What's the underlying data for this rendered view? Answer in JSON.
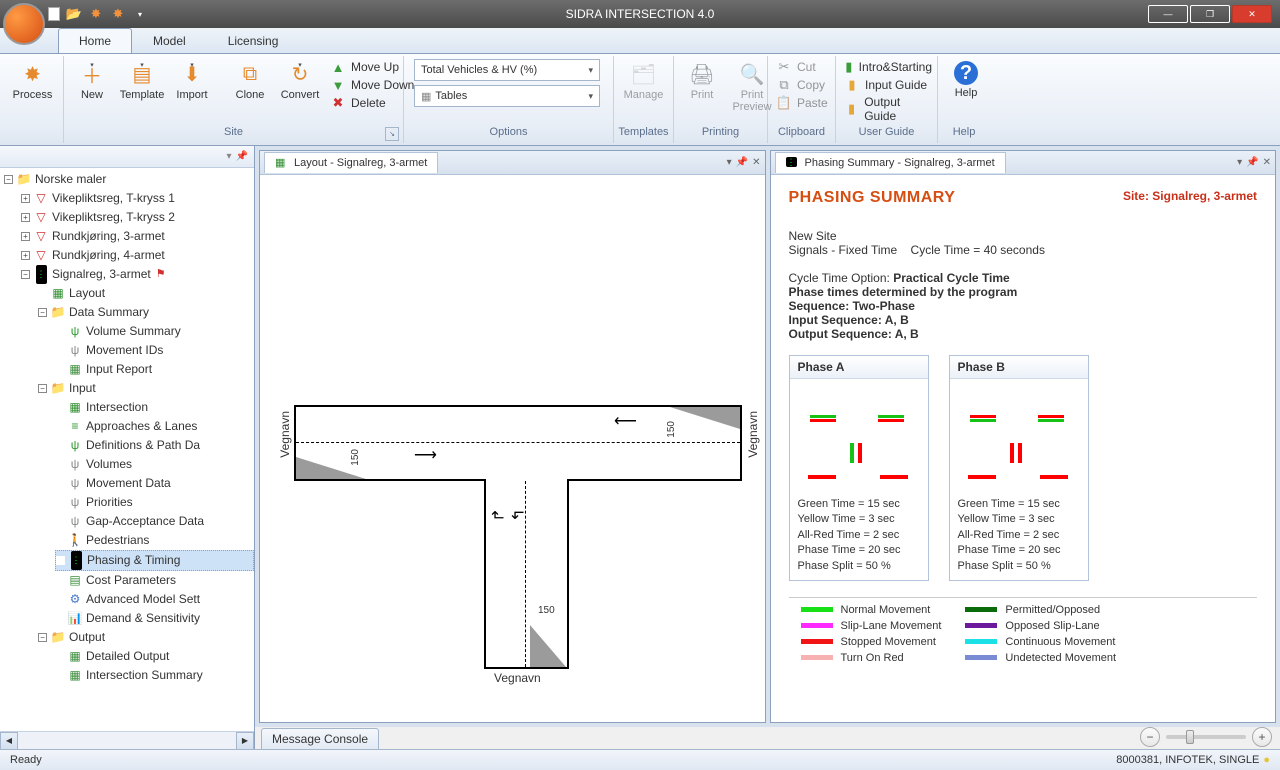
{
  "app": {
    "title": "SIDRA INTERSECTION 4.0"
  },
  "tabs": {
    "home": "Home",
    "model": "Model",
    "licensing": "Licensing"
  },
  "ribbon": {
    "process": "Process",
    "new": "New",
    "template": "Template",
    "import": "Import",
    "clone": "Clone",
    "convert": "Convert",
    "moveup": "Move Up",
    "movedown": "Move Down",
    "delete": "Delete",
    "combo1": "Total Vehicles & HV (%)",
    "combo2": "Tables",
    "manage": "Manage",
    "print": "Print",
    "print_preview_l1": "Print",
    "print_preview_l2": "Preview",
    "cut": "Cut",
    "copy": "Copy",
    "paste": "Paste",
    "intro": "Intro&Starting",
    "input_guide": "Input Guide",
    "output_guide": "Output Guide",
    "help": "Help",
    "groups": {
      "site_proc": "",
      "site": "Site",
      "options": "Options",
      "templates": "Templates",
      "printing": "Printing",
      "clipboard": "Clipboard",
      "userguide": "User Guide",
      "help": "Help"
    }
  },
  "tree": {
    "root": "Norske maler",
    "n1": "Vikepliktsreg, T-kryss 1",
    "n2": "Vikepliktsreg, T-kryss 2",
    "n3": "Rundkjøring, 3-armet",
    "n4": "Rundkjøring, 4-armet",
    "n5": "Signalreg, 3-armet",
    "layout": "Layout",
    "data_summary": "Data Summary",
    "vol_summary": "Volume Summary",
    "movement_ids": "Movement IDs",
    "input_report": "Input Report",
    "input": "Input",
    "intersection": "Intersection",
    "approaches": "Approaches & Lanes",
    "definitions": "Definitions & Path Da",
    "volumes": "Volumes",
    "movement_data": "Movement Data",
    "priorities": "Priorities",
    "gap": "Gap-Acceptance Data",
    "pedestrians": "Pedestrians",
    "phasing_timing": "Phasing & Timing",
    "cost": "Cost Parameters",
    "adv": "Advanced Model Sett",
    "demand": "Demand & Sensitivity",
    "output": "Output",
    "detailed": "Detailed Output",
    "isummary": "Intersection Summary"
  },
  "layout_tab": "Layout - Signalreg, 3-armet",
  "phasing_tab": "Phasing Summary - Signalreg, 3-armet",
  "layout": {
    "veg_left": "Vegnavn",
    "veg_right": "Vegnavn",
    "veg_bottom": "Vegnavn",
    "d150a": "150",
    "d150b": "150",
    "d150c": "150"
  },
  "phasing": {
    "title": "PHASING SUMMARY",
    "site_label": "Site: Signalreg, 3-armet",
    "new_site": "New Site",
    "signals": "Signals - Fixed Time",
    "cycle": "Cycle Time = 40 seconds",
    "cto_label": "Cycle Time Option:",
    "cto_val": "Practical Cycle Time",
    "p2": "Phase times determined by the program",
    "seq": "Sequence: Two-Phase",
    "inseq": "Input Sequence: A, B",
    "outseq": "Output Sequence: A, B",
    "ph_a": "Phase A",
    "ph_b": "Phase B",
    "green": "Green Time = 15 sec",
    "yellow": "Yellow Time = 3 sec",
    "allred": "All-Red Time = 2 sec",
    "ptime": "Phase Time = 20 sec",
    "psplit": "Phase Split = 50 %"
  },
  "legend": {
    "normal": "Normal Movement",
    "slip": "Slip-Lane Movement",
    "stopped": "Stopped Movement",
    "tor": "Turn On Red",
    "permitted": "Permitted/Opposed",
    "opp_slip": "Opposed Slip-Lane",
    "continuous": "Continuous Movement",
    "undetected": "Undetected Movement"
  },
  "msg_console": "Message Console",
  "status": {
    "ready": "Ready",
    "right": "8000381, INFOTEK, SINGLE"
  }
}
